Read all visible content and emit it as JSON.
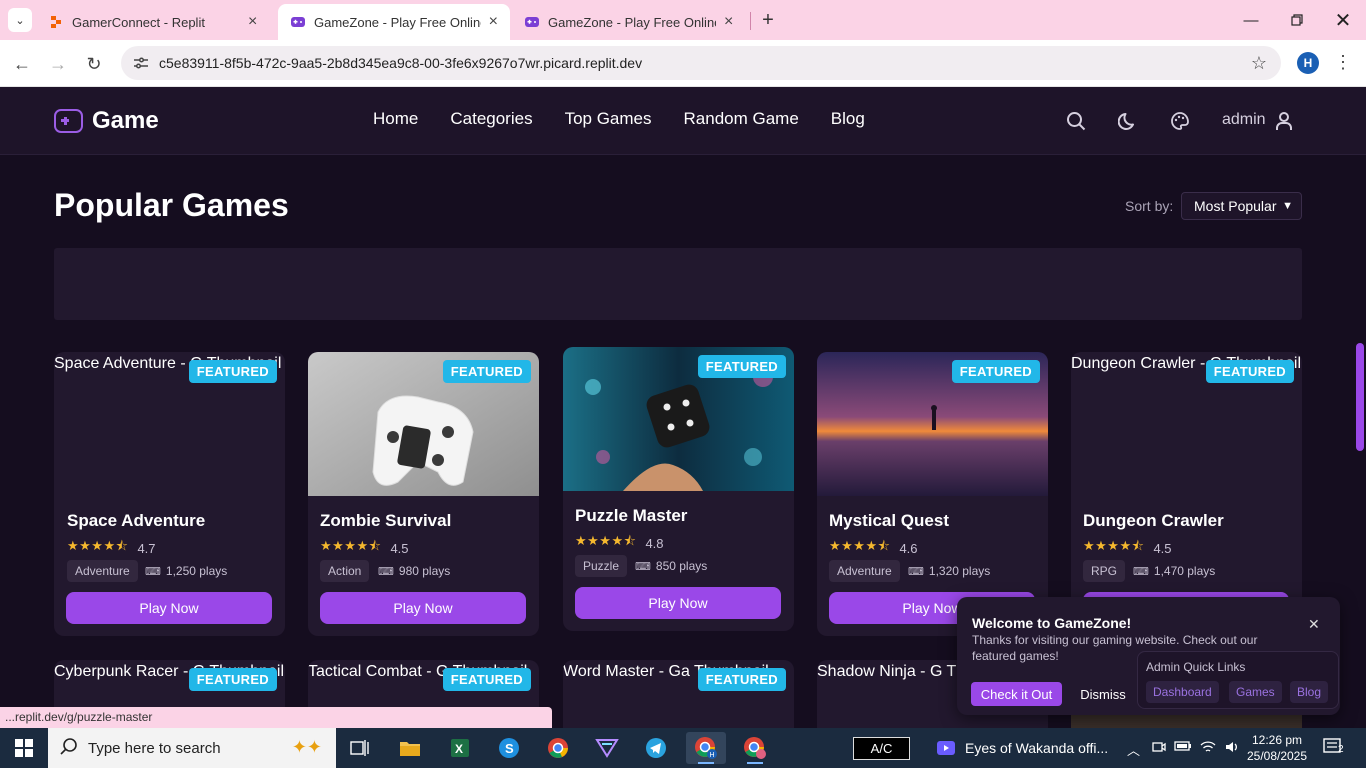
{
  "browser": {
    "tabs": [
      {
        "title": "GamerConnect - Replit",
        "active": false
      },
      {
        "title": "GameZone - Play Free Online G",
        "active": true
      },
      {
        "title": "GameZone - Play Free Online G",
        "active": false
      }
    ],
    "url": "c5e83911-8f5b-472c-9aa5-2b8d345ea9c8-00-3fe6x9267o7wr.picard.replit.dev",
    "profile_initial": "H",
    "status_url": "...replit.dev/g/puzzle-master"
  },
  "header": {
    "logo": "Game",
    "nav": [
      "Home",
      "Categories",
      "Top Games",
      "Random Game",
      "Blog"
    ],
    "user": "admin"
  },
  "main": {
    "title": "Popular Games",
    "sort_label": "Sort by:",
    "sort_value": "Most Popular",
    "badge_label": "FEATURED",
    "play_label": "Play Now",
    "games": [
      {
        "name": "Space Adventure",
        "alt": "Space Adventure - G Thumbnail",
        "rating": "4.7",
        "stars": 4.5,
        "genre": "Adventure",
        "plays": "1,250 plays"
      },
      {
        "name": "Zombie Survival",
        "alt": "",
        "rating": "4.5",
        "stars": 4.5,
        "genre": "Action",
        "plays": "980 plays"
      },
      {
        "name": "Puzzle Master",
        "alt": "",
        "rating": "4.8",
        "stars": 4.5,
        "genre": "Puzzle",
        "plays": "850 plays"
      },
      {
        "name": "Mystical Quest",
        "alt": "",
        "rating": "4.6",
        "stars": 4.5,
        "genre": "Adventure",
        "plays": "1,320 plays"
      },
      {
        "name": "Dungeon Crawler",
        "alt": "Dungeon Crawler - G Thumbnail",
        "rating": "4.5",
        "stars": 4.5,
        "genre": "RPG",
        "plays": "1,470 plays"
      }
    ],
    "games_row2": [
      {
        "alt": "Cyberpunk Racer - G Thumbnail",
        "featured": true
      },
      {
        "alt": "Tactical Combat - G Thumbnail",
        "featured": true
      },
      {
        "alt": "Word Master - Ga Thumbnail",
        "featured": true
      },
      {
        "alt": "Shadow Ninja - G Thumbnail",
        "featured": false
      }
    ]
  },
  "popup": {
    "title": "Welcome to GameZone!",
    "message": "Thanks for visiting our gaming website. Check out our featured games!",
    "check_label": "Check it Out",
    "dismiss_label": "Dismiss"
  },
  "quick_links": {
    "title": "Admin Quick Links",
    "links": [
      "Dashboard",
      "Games",
      "Blog"
    ]
  },
  "taskbar": {
    "search_placeholder": "Type here to search",
    "ac_label": "A/C",
    "media": "Eyes of Wakanda offi...",
    "time": "12:26 pm",
    "date": "25/08/2025",
    "notifications": "2"
  },
  "colors": {
    "accent": "#9a48e8",
    "badge": "#22b7e8",
    "bg": "#150d1f",
    "card": "#22182e"
  }
}
